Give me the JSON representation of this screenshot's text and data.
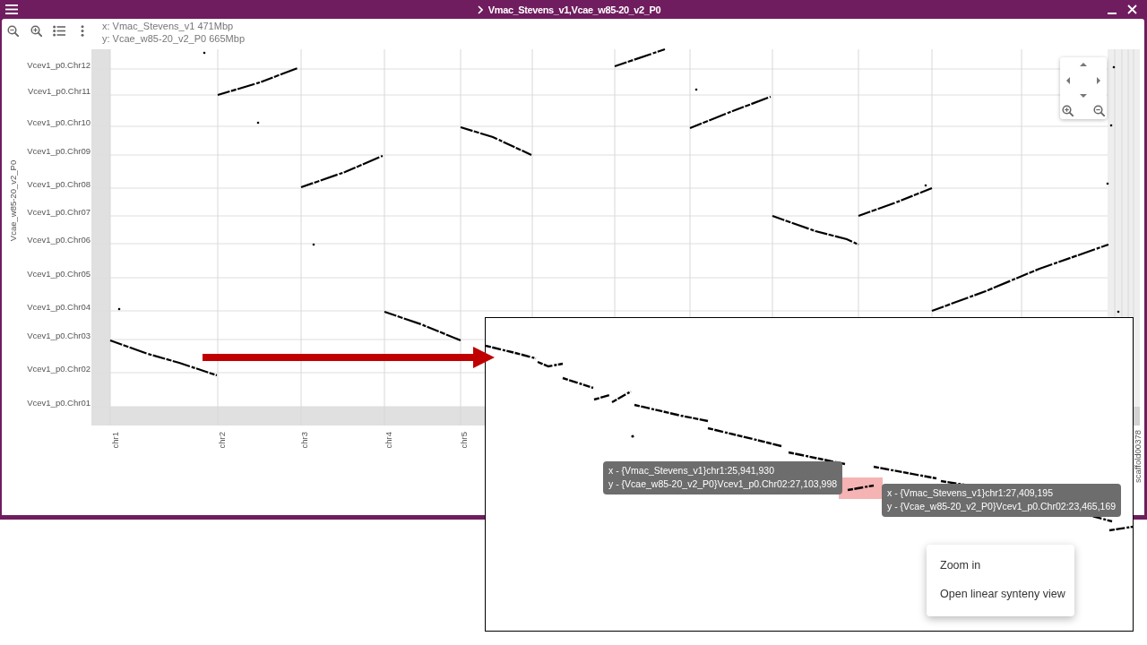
{
  "window": {
    "title": "Vmac_Stevens_v1,Vcae_w85-20_v2_P0"
  },
  "axis_info": [
    "x: Vmac_Stevens_v1 471Mbp",
    "y: Vcae_w85-20_v2_P0 665Mbp"
  ],
  "plot": {
    "y_title": "Vcae_w85-20_v2_P0",
    "y_labels": [
      "Vcev1_p0.Chr12",
      "Vcev1_p0.Chr11",
      "Vcev1_p0.Chr10",
      "Vcev1_p0.Chr09",
      "Vcev1_p0.Chr08",
      "Vcev1_p0.Chr07",
      "Vcev1_p0.Chr06",
      "Vcev1_p0.Chr05",
      "Vcev1_p0.Chr04",
      "Vcev1_p0.Chr03",
      "Vcev1_p0.Chr02",
      "Vcev1_p0.Chr01"
    ],
    "x_labels": [
      "chr1",
      "chr2",
      "chr3",
      "chr4",
      "chr5"
    ],
    "x_label_end": "scaffold00378"
  },
  "inset": {
    "tooltips": [
      {
        "lines": [
          "x - {Vmac_Stevens_v1}chr1:25,941,930",
          "y - {Vcae_w85-20_v2_P0}Vcev1_p0.Chr02:27,103,998"
        ]
      },
      {
        "lines": [
          "x - {Vmac_Stevens_v1}chr1:27,409,195",
          "y - {Vcae_w85-20_v2_P0}Vcev1_p0.Chr02:23,465,169"
        ]
      }
    ],
    "context_menu": [
      "Zoom in",
      "Open linear synteny view"
    ]
  }
}
